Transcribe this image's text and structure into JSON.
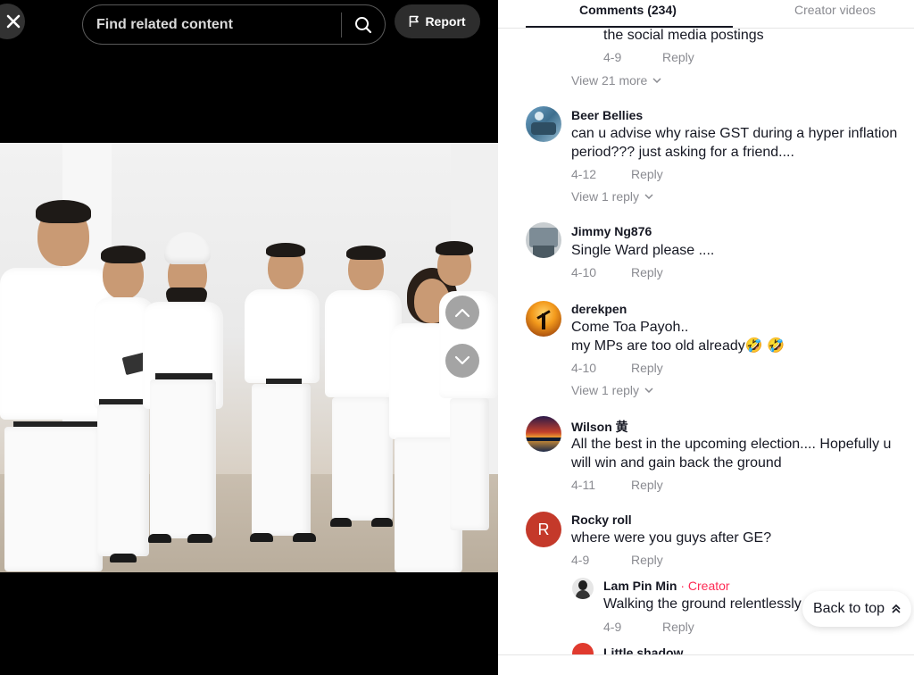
{
  "player": {
    "search_placeholder": "Find related content",
    "report_label": "Report"
  },
  "tabs": {
    "comments_label": "Comments (234)",
    "creator_videos_label": "Creator videos"
  },
  "comments": [
    {
      "text": "the social media postings",
      "date": "4-9",
      "reply": "Reply",
      "more": "View 21 more"
    },
    {
      "user": "Beer Bellies",
      "text_line1": "can u advise why raise GST during a hyper inflation",
      "text_line2": "period??? just asking for a friend....",
      "date": "4-12",
      "reply": "Reply",
      "more": "View 1 reply"
    },
    {
      "user": "Jimmy Ng876",
      "text": "Single Ward please ....",
      "date": "4-10",
      "reply": "Reply"
    },
    {
      "user": "derekpen",
      "text_line1": "Come Toa Payoh..",
      "text_line2": "my MPs are too old already🤣 🤣",
      "date": "4-10",
      "reply": "Reply",
      "more": "View 1 reply"
    },
    {
      "user": "Wilson 黄",
      "text_line1": "All the best in the upcoming election.... Hopefully u",
      "text_line2": "will win and gain back the ground",
      "date": "4-11",
      "reply": "Reply"
    },
    {
      "user": "Rocky roll",
      "avatar_letter": "R",
      "text": "where were you guys after GE?",
      "date": "4-9",
      "reply": "Reply"
    },
    {
      "user": "Lam Pin Min",
      "separator": " · ",
      "creator_tag": "Creator",
      "text": "Walking the ground relentlessly",
      "date": "4-9",
      "reply": "Reply"
    },
    {
      "user": "Little shadow"
    }
  ],
  "back_to_top": "Back to top",
  "colors": {
    "creator_tag": "#fe2c55",
    "rocky_avatar": "#c4392a",
    "meta_text": "#8a8b91"
  },
  "icons": [
    "close-icon",
    "search-icon",
    "flag-icon",
    "chevron-up-icon",
    "chevron-down-icon",
    "double-chevron-up-icon"
  ]
}
